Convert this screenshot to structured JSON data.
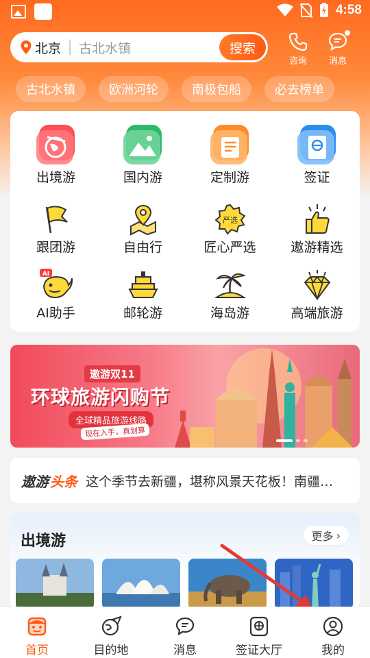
{
  "status_bar": {
    "time": "4:58"
  },
  "header": {
    "city": "北京",
    "search_placeholder": "古北水镇",
    "search_button": "搜索",
    "consult_label": "咨询",
    "message_label": "消息"
  },
  "chips": [
    "古北水镇",
    "欧洲河轮",
    "南极包船",
    "必去榜单"
  ],
  "categories": [
    {
      "label": "出境游",
      "icon": "outbound-icon"
    },
    {
      "label": "国内游",
      "icon": "domestic-icon"
    },
    {
      "label": "定制游",
      "icon": "custom-icon"
    },
    {
      "label": "签证",
      "icon": "visa-icon"
    },
    {
      "label": "跟团游",
      "icon": "flag-icon"
    },
    {
      "label": "自由行",
      "icon": "map-pin-icon"
    },
    {
      "label": "匠心严选",
      "icon": "selection-badge-icon"
    },
    {
      "label": "遨游精选",
      "icon": "thumbs-up-icon"
    },
    {
      "label": "AI助手",
      "icon": "ai-whale-icon",
      "badge": "AI"
    },
    {
      "label": "邮轮游",
      "icon": "cruise-ship-icon"
    },
    {
      "label": "海岛游",
      "icon": "palm-island-icon"
    },
    {
      "label": "高端旅游",
      "icon": "diamond-icon"
    }
  ],
  "banner": {
    "tag": "遨游双11",
    "headline": "环球旅游闪购节",
    "subline": "全球精品旅游线路",
    "note": "现在入手，真划算"
  },
  "news": {
    "logo_a": "遨游",
    "logo_b": "头条",
    "text": "这个季节去新疆，堪称风景天花板！南疆秋色正浓"
  },
  "section": {
    "title": "出境游",
    "more": "更多"
  },
  "tabs": [
    {
      "label": "首页",
      "icon": "home-face-icon",
      "active": true
    },
    {
      "label": "目的地",
      "icon": "globe-plane-icon"
    },
    {
      "label": "消息",
      "icon": "chat-bubble-icon"
    },
    {
      "label": "签证大厅",
      "icon": "passport-icon"
    },
    {
      "label": "我的",
      "icon": "user-icon"
    }
  ],
  "colors": {
    "accent": "#ff5a14",
    "header_orange": "#ff6a1f",
    "annotation_arrow": "#e53935"
  }
}
